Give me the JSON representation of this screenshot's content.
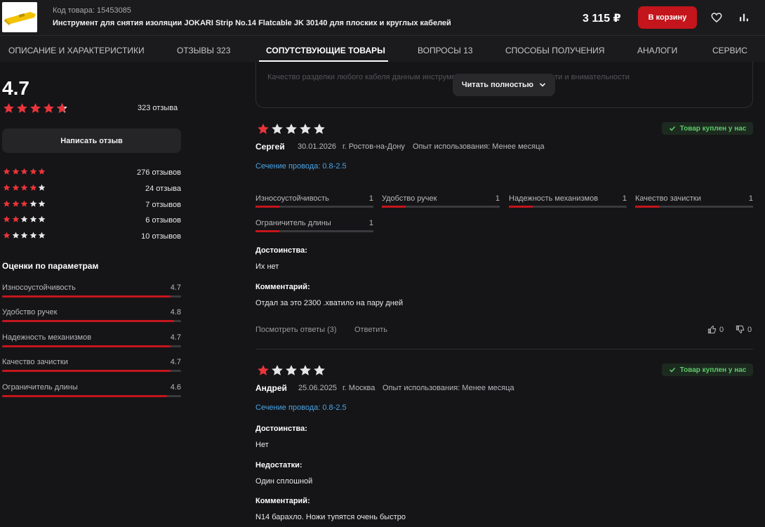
{
  "header": {
    "product_code": "Код товара: 15453085",
    "product_title": "Инструмент для снятия изоляции JOKARI Strip No.14 Flatcable JK 30140 для плоских и круглых кабелей",
    "price": "3 115 ₽",
    "cart_label": "В корзину"
  },
  "tabs": [
    {
      "label": "ОПИСАНИЕ И ХАРАКТЕРИСТИКИ"
    },
    {
      "label": "ОТЗЫВЫ 323"
    },
    {
      "label": "СОПУТСТВУЮЩИЕ ТОВАРЫ",
      "active": true
    },
    {
      "label": "ВОПРОСЫ 13"
    },
    {
      "label": "СПОСОБЫ ПОЛУЧЕНИЯ"
    },
    {
      "label": "АНАЛОГИ"
    },
    {
      "label": "СЕРВИС"
    }
  ],
  "summary": {
    "rating": "4.7",
    "rating_stars": 4.7,
    "total_reviews": "323 отзыва",
    "write_review": "Написать отзыв",
    "distribution": [
      {
        "stars": 5,
        "label": "276 отзывов"
      },
      {
        "stars": 4,
        "label": "24 отзыва"
      },
      {
        "stars": 3,
        "label": "7 отзывов"
      },
      {
        "stars": 2,
        "label": "6 отзывов"
      },
      {
        "stars": 1,
        "label": "10 отзывов"
      }
    ]
  },
  "params": {
    "title": "Оценки по параметрам",
    "items": [
      {
        "name": "Износоустойчивость",
        "value": "4.7",
        "score": 4.7
      },
      {
        "name": "Удобство ручек",
        "value": "4.8",
        "score": 4.8
      },
      {
        "name": "Надежность механизмов",
        "value": "4.7",
        "score": 4.7
      },
      {
        "name": "Качество зачистки",
        "value": "4.7",
        "score": 4.7
      },
      {
        "name": "Ограничитель длины",
        "value": "4.6",
        "score": 4.6
      }
    ]
  },
  "top_card": {
    "text": "Качество разделки любого кабеля данным инструментом зависит от аккуратности и внимательности",
    "read_more": "Читать полностью"
  },
  "reviews": [
    {
      "stars": 1,
      "author": "Сергей",
      "date": "30.01.2026",
      "city": "г. Ростов-на-Дону",
      "experience": "Опыт использования: Менее месяца",
      "bought": "Товар куплен у нас",
      "section": "Сечение провода: 0.8-2.5",
      "criteria": [
        {
          "name": "Износоустойчивость",
          "value": "1"
        },
        {
          "name": "Удобство ручек",
          "value": "1"
        },
        {
          "name": "Надежность механизмов",
          "value": "1"
        },
        {
          "name": "Качество зачистки",
          "value": "1"
        },
        {
          "name": "Ограничитель длины",
          "value": "1"
        }
      ],
      "pros_label": "Достоинства:",
      "pros": "Их нет",
      "comment_label": "Комментарий:",
      "comment": "Отдал за это 2300 .хватило на пару дней",
      "answers": "Посмотреть ответы (3)",
      "reply": "Ответить",
      "likes": "0",
      "dislikes": "0"
    },
    {
      "stars": 1,
      "author": "Андрей",
      "date": "25.06.2025",
      "city": "г. Москва",
      "experience": "Опыт использования: Менее месяца",
      "bought": "Товар куплен у нас",
      "section": "Сечение провода: 0.8-2.5",
      "pros_label": "Достоинства:",
      "pros": "Нет",
      "cons_label": "Недостатки:",
      "cons": "Один сплошной",
      "comment_label": "Комментарий:",
      "comment": "N14 барахло. Ножи тупятся очень быстро"
    }
  ],
  "colors": {
    "accent": "#c4151c",
    "star_on": "#e8353b",
    "star_off": "#e6e6e6",
    "badge_green": "#5dca6a",
    "link_blue": "#4aa3e6"
  }
}
